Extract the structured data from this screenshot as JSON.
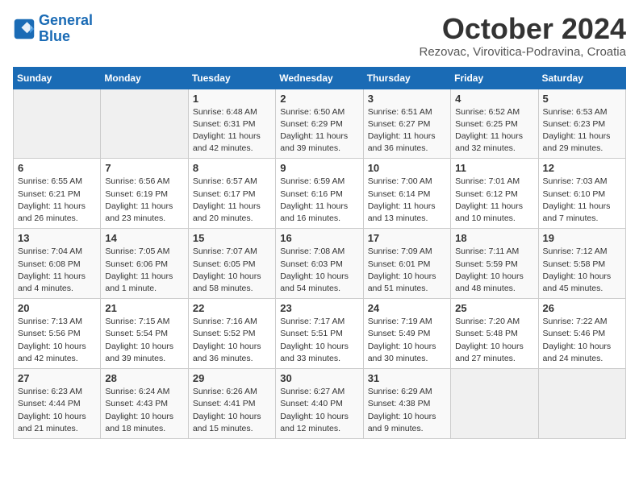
{
  "logo": {
    "line1": "General",
    "line2": "Blue"
  },
  "title": "October 2024",
  "subtitle": "Rezovac, Virovitica-Podravina, Croatia",
  "days_of_week": [
    "Sunday",
    "Monday",
    "Tuesday",
    "Wednesday",
    "Thursday",
    "Friday",
    "Saturday"
  ],
  "weeks": [
    [
      {
        "num": "",
        "info": ""
      },
      {
        "num": "",
        "info": ""
      },
      {
        "num": "1",
        "info": "Sunrise: 6:48 AM\nSunset: 6:31 PM\nDaylight: 11 hours and 42 minutes."
      },
      {
        "num": "2",
        "info": "Sunrise: 6:50 AM\nSunset: 6:29 PM\nDaylight: 11 hours and 39 minutes."
      },
      {
        "num": "3",
        "info": "Sunrise: 6:51 AM\nSunset: 6:27 PM\nDaylight: 11 hours and 36 minutes."
      },
      {
        "num": "4",
        "info": "Sunrise: 6:52 AM\nSunset: 6:25 PM\nDaylight: 11 hours and 32 minutes."
      },
      {
        "num": "5",
        "info": "Sunrise: 6:53 AM\nSunset: 6:23 PM\nDaylight: 11 hours and 29 minutes."
      }
    ],
    [
      {
        "num": "6",
        "info": "Sunrise: 6:55 AM\nSunset: 6:21 PM\nDaylight: 11 hours and 26 minutes."
      },
      {
        "num": "7",
        "info": "Sunrise: 6:56 AM\nSunset: 6:19 PM\nDaylight: 11 hours and 23 minutes."
      },
      {
        "num": "8",
        "info": "Sunrise: 6:57 AM\nSunset: 6:17 PM\nDaylight: 11 hours and 20 minutes."
      },
      {
        "num": "9",
        "info": "Sunrise: 6:59 AM\nSunset: 6:16 PM\nDaylight: 11 hours and 16 minutes."
      },
      {
        "num": "10",
        "info": "Sunrise: 7:00 AM\nSunset: 6:14 PM\nDaylight: 11 hours and 13 minutes."
      },
      {
        "num": "11",
        "info": "Sunrise: 7:01 AM\nSunset: 6:12 PM\nDaylight: 11 hours and 10 minutes."
      },
      {
        "num": "12",
        "info": "Sunrise: 7:03 AM\nSunset: 6:10 PM\nDaylight: 11 hours and 7 minutes."
      }
    ],
    [
      {
        "num": "13",
        "info": "Sunrise: 7:04 AM\nSunset: 6:08 PM\nDaylight: 11 hours and 4 minutes."
      },
      {
        "num": "14",
        "info": "Sunrise: 7:05 AM\nSunset: 6:06 PM\nDaylight: 11 hours and 1 minute."
      },
      {
        "num": "15",
        "info": "Sunrise: 7:07 AM\nSunset: 6:05 PM\nDaylight: 10 hours and 58 minutes."
      },
      {
        "num": "16",
        "info": "Sunrise: 7:08 AM\nSunset: 6:03 PM\nDaylight: 10 hours and 54 minutes."
      },
      {
        "num": "17",
        "info": "Sunrise: 7:09 AM\nSunset: 6:01 PM\nDaylight: 10 hours and 51 minutes."
      },
      {
        "num": "18",
        "info": "Sunrise: 7:11 AM\nSunset: 5:59 PM\nDaylight: 10 hours and 48 minutes."
      },
      {
        "num": "19",
        "info": "Sunrise: 7:12 AM\nSunset: 5:58 PM\nDaylight: 10 hours and 45 minutes."
      }
    ],
    [
      {
        "num": "20",
        "info": "Sunrise: 7:13 AM\nSunset: 5:56 PM\nDaylight: 10 hours and 42 minutes."
      },
      {
        "num": "21",
        "info": "Sunrise: 7:15 AM\nSunset: 5:54 PM\nDaylight: 10 hours and 39 minutes."
      },
      {
        "num": "22",
        "info": "Sunrise: 7:16 AM\nSunset: 5:52 PM\nDaylight: 10 hours and 36 minutes."
      },
      {
        "num": "23",
        "info": "Sunrise: 7:17 AM\nSunset: 5:51 PM\nDaylight: 10 hours and 33 minutes."
      },
      {
        "num": "24",
        "info": "Sunrise: 7:19 AM\nSunset: 5:49 PM\nDaylight: 10 hours and 30 minutes."
      },
      {
        "num": "25",
        "info": "Sunrise: 7:20 AM\nSunset: 5:48 PM\nDaylight: 10 hours and 27 minutes."
      },
      {
        "num": "26",
        "info": "Sunrise: 7:22 AM\nSunset: 5:46 PM\nDaylight: 10 hours and 24 minutes."
      }
    ],
    [
      {
        "num": "27",
        "info": "Sunrise: 6:23 AM\nSunset: 4:44 PM\nDaylight: 10 hours and 21 minutes."
      },
      {
        "num": "28",
        "info": "Sunrise: 6:24 AM\nSunset: 4:43 PM\nDaylight: 10 hours and 18 minutes."
      },
      {
        "num": "29",
        "info": "Sunrise: 6:26 AM\nSunset: 4:41 PM\nDaylight: 10 hours and 15 minutes."
      },
      {
        "num": "30",
        "info": "Sunrise: 6:27 AM\nSunset: 4:40 PM\nDaylight: 10 hours and 12 minutes."
      },
      {
        "num": "31",
        "info": "Sunrise: 6:29 AM\nSunset: 4:38 PM\nDaylight: 10 hours and 9 minutes."
      },
      {
        "num": "",
        "info": ""
      },
      {
        "num": "",
        "info": ""
      }
    ]
  ]
}
